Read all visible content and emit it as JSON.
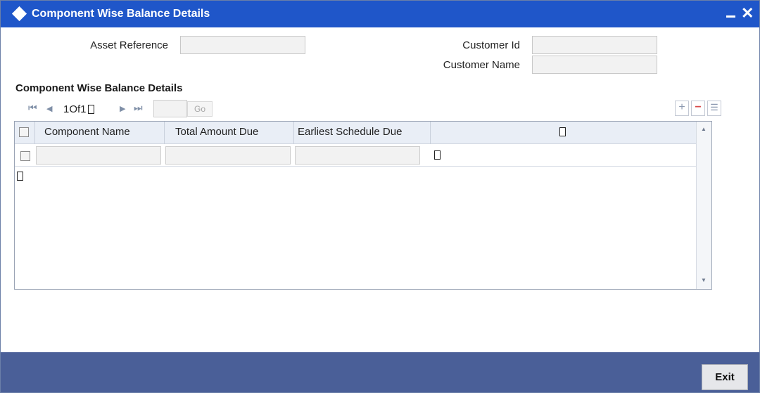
{
  "window": {
    "title": "Component Wise Balance Details"
  },
  "form": {
    "asset_reference_label": "Asset Reference",
    "asset_reference_value": "",
    "customer_id_label": "Customer Id",
    "customer_id_value": "",
    "customer_name_label": "Customer Name",
    "customer_name_value": ""
  },
  "section": {
    "title": "Component Wise Balance Details"
  },
  "pagination": {
    "page_info": "1Of1",
    "page_input_value": "",
    "go_label": "Go"
  },
  "grid": {
    "columns": [
      "Component Name",
      "Total Amount Due",
      "Earliest Schedule Due"
    ],
    "rows": [
      {
        "component_name": "",
        "total_amount_due": "",
        "earliest_schedule_due": ""
      }
    ]
  },
  "footer": {
    "exit_label": "Exit"
  }
}
